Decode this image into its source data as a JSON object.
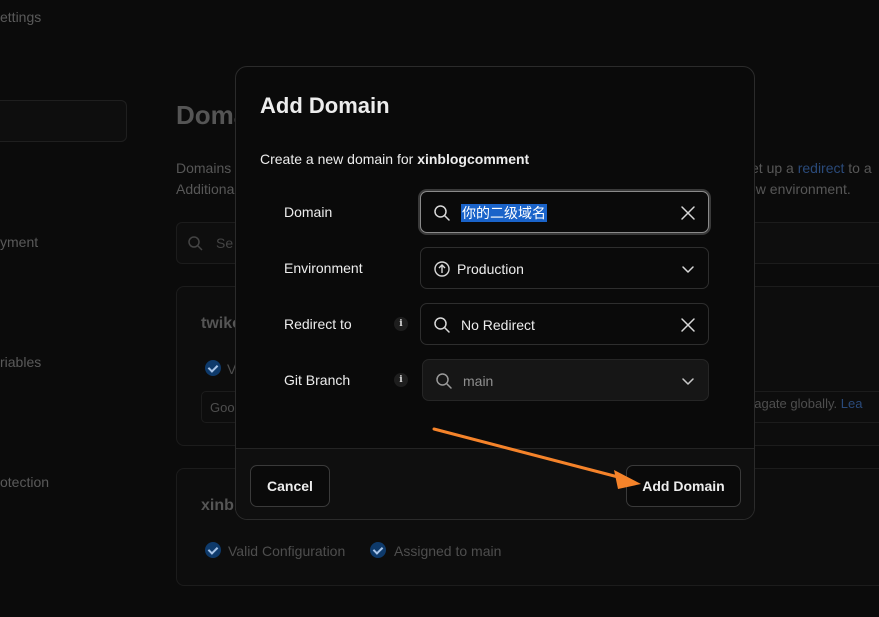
{
  "background": {
    "sidebar": [
      "ettings",
      "yment",
      "riables",
      "otection"
    ],
    "title": "Doma",
    "desc_left_1": "Domains",
    "desc_left_2": "Additiona",
    "desc_right_1_a": "set up a ",
    "desc_right_1_link": "redirect",
    "desc_right_1_b": " to a",
    "desc_right_2": "ew environment.",
    "search_placeholder": "Se",
    "card1": {
      "name": "twiko",
      "status": "V",
      "inner_text": "Good",
      "inner_right": "pagate globally.",
      "inner_link": "Lea"
    },
    "card2": {
      "name": "xinbl",
      "status1": "Valid Configuration",
      "status2": "Assigned to main"
    }
  },
  "modal": {
    "title": "Add Domain",
    "subtitle_prefix": "Create a new domain for ",
    "project": "xinblogcomment",
    "fields": {
      "domain": {
        "label": "Domain",
        "value": "你的二级域名"
      },
      "environment": {
        "label": "Environment",
        "value": "Production"
      },
      "redirect": {
        "label": "Redirect to",
        "value": "No Redirect"
      },
      "branch": {
        "label": "Git Branch",
        "value": "main"
      }
    },
    "info_glyph": "i",
    "cancel_label": "Cancel",
    "submit_label": "Add Domain"
  },
  "colors": {
    "accent_arrow": "#f5832a",
    "selection": "#1a63c9"
  },
  "icons": {
    "search": "search-icon",
    "clear": "close-icon",
    "env": "arrow-up-circle-icon",
    "chevron": "chevron-down-icon",
    "info": "info-icon"
  }
}
